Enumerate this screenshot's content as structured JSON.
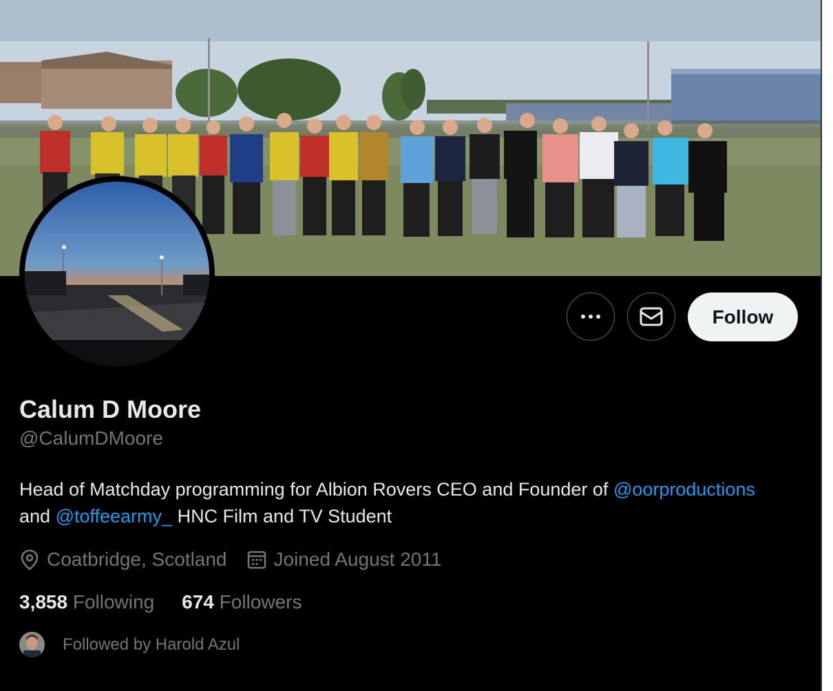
{
  "profile": {
    "name": "Calum D Moore",
    "handle": "@CalumDMoore",
    "bio_text_1": "Head of Matchday programming for Albion Rovers CEO and Founder of ",
    "bio_mention_1": "@oorproductions",
    "bio_text_2": " and ",
    "bio_mention_2": "@toffeearmy_",
    "bio_text_3": " HNC Film and TV Student",
    "location": "Coatbridge, Scotland",
    "joined": "Joined August 2011"
  },
  "stats": {
    "following_count": "3,858",
    "following_label": "Following",
    "followers_count": "674",
    "followers_label": "Followers"
  },
  "followed_by": "Followed by Harold Azul",
  "actions": {
    "more_icon": "more-icon",
    "message_icon": "mail-icon",
    "follow_label": "Follow"
  },
  "icons": {
    "location": "location-pin-icon",
    "calendar": "calendar-icon"
  },
  "colors": {
    "link": "#1d9bf0",
    "muted": "#71767b",
    "text": "#e7e9ea",
    "follow_bg": "#eff3f4"
  }
}
